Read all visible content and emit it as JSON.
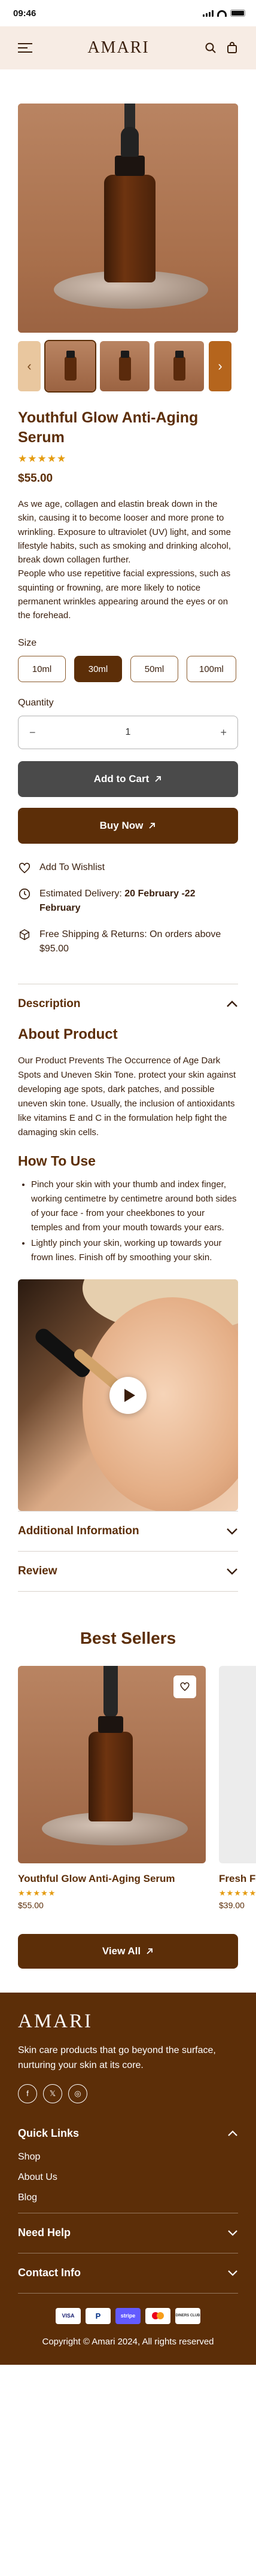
{
  "status_bar": {
    "time": "09:46"
  },
  "header": {
    "logo": "AMARI"
  },
  "product": {
    "title": "Youthful Glow Anti-Aging Serum",
    "rating_stars": "★★★★★",
    "price": "$55.00",
    "description": [
      "As we age, collagen and elastin break down in the skin, causing it to become looser and more prone to wrinkling. Exposure to ultraviolet (UV) light, and some lifestyle habits, such as smoking and drinking alcohol, break down collagen further.",
      "People who use repetitive facial expressions, such as squinting or frowning, are more likely to notice permanent wrinkles appearing around the eyes or on the forehead."
    ],
    "size_label": "Size",
    "sizes": [
      "10ml",
      "30ml",
      "50ml",
      "100ml"
    ],
    "selected_size": "30ml",
    "quantity_label": "Quantity",
    "quantity": "1",
    "add_to_cart": "Add to Cart",
    "buy_now": "Buy Now",
    "wishlist": "Add To Wishlist",
    "delivery_label": "Estimated Delivery:",
    "delivery_dates": "20 February -22 February",
    "shipping": "Free Shipping & Returns: On orders above $95.00"
  },
  "description_section": {
    "heading": "Description",
    "about_title": "About Product",
    "about_text": "Our Product Prevents The Occurrence of Age Dark Spots and Uneven Skin Tone. protect your skin against developing age spots, dark patches, and possible uneven skin tone. Usually, the inclusion of antioxidants like vitamins E and C in the formulation help fight the damaging skin cells.",
    "howto_title": "How To Use",
    "howto_items": [
      "Pinch your skin with your thumb and index finger, working centimetre by centimetre around both sides of your face - from your cheekbones to your temples and from your mouth towards your ears.",
      "Lightly pinch your skin, working up towards your frown lines. Finish off by smoothing your skin."
    ]
  },
  "accordions": {
    "additional_info": "Additional Information",
    "review": "Review"
  },
  "best_sellers": {
    "title": "Best Sellers",
    "items": [
      {
        "name": "Youthful Glow Anti-Aging Serum",
        "stars": "★★★★★",
        "price": "$55.00"
      },
      {
        "name": "Fresh Face Cleanser",
        "stars": "★★★★★",
        "price": "$39.00"
      }
    ],
    "view_all": "View All"
  },
  "footer": {
    "logo": "AMARI",
    "tagline": "Skin care products that go beyond the surface, nurturing your skin at its core.",
    "quick_links_title": "Quick Links",
    "quick_links": [
      "Shop",
      "About Us",
      "Blog"
    ],
    "need_help": "Need Help",
    "contact_info": "Contact Info",
    "payments": [
      "VISA",
      "PayPal",
      "stripe",
      "Mastercard",
      "Diners"
    ],
    "copyright": "Copyright © Amari 2024, All rights reserved"
  },
  "colors": {
    "brand": "#5c2e08",
    "header_bg": "#f7ece4",
    "star": "#e49b0f",
    "accent": "#b5651d"
  }
}
